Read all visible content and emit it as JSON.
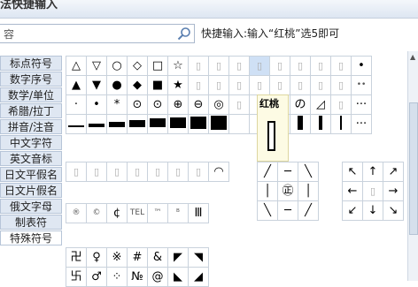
{
  "title": "法快捷输入",
  "search": {
    "placeholder": "容"
  },
  "hint": "快捷输入:输入“红桃”选5即可",
  "categories": [
    "标点符号",
    "数字序号",
    "数学/单位",
    "希腊/拉丁",
    "拼音/注音",
    "中文字符",
    "英文音标",
    "日文平假名",
    "日文片假名",
    "俄文字母",
    "制表符",
    "特殊符号"
  ],
  "grid1": {
    "row1": [
      "△",
      "▽",
      "○",
      "◇",
      "□",
      "☆",
      "▯",
      "▯",
      "▯",
      "▯",
      "▯",
      "▯",
      "▯",
      "▯",
      "•"
    ],
    "row2": [
      "▲",
      "▼",
      "●",
      "◆",
      "■",
      "★",
      "▯",
      "▯",
      "▯",
      "▯",
      "▯",
      "▯",
      "▯",
      "▯",
      "••"
    ],
    "row3": [
      "·",
      "•",
      "*",
      "⊙",
      "⊙",
      "⊕",
      "⊖",
      "◎",
      "▯",
      "▯",
      "▯",
      "の",
      "◿",
      "▯",
      "···"
    ],
    "row5_end": "···"
  },
  "popup": {
    "label": "红桃"
  },
  "grid2": [
    "▯",
    "▯",
    "▯",
    "▯",
    "▯",
    "▯",
    "▯",
    "◠"
  ],
  "grid3": [
    "®",
    "©",
    "¢",
    "TEL",
    "™",
    "ᴮ",
    "Ⅲ"
  ],
  "grid4": [
    "╱",
    "─",
    "╲",
    "│",
    "㊣",
    "│",
    "╲",
    "─",
    "╱"
  ],
  "grid5": [
    "↖",
    "↑",
    "↗",
    "←",
    "▯",
    "→",
    "↙",
    "↓",
    "↘"
  ],
  "grid6": [
    "卍",
    "♀",
    "※",
    "#",
    "&",
    "◤",
    "◥",
    "卐",
    "♂",
    "⁘",
    "№",
    "@",
    "◣",
    "◢"
  ]
}
